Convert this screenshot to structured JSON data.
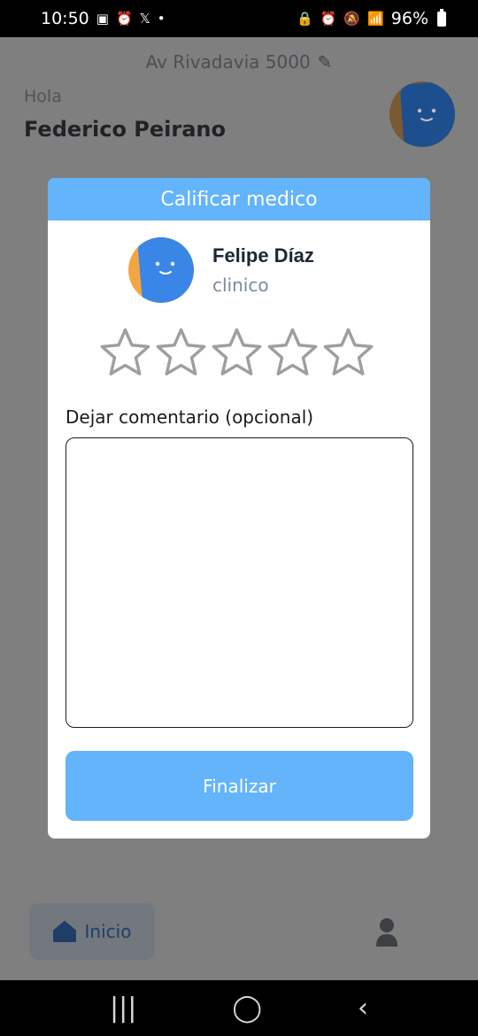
{
  "status_bar": {
    "time": "10:50",
    "battery": "96%",
    "icons": [
      "image-icon",
      "alarm-icon",
      "x-icon",
      "dot-icon",
      "lock-icon",
      "alarm-icon",
      "mute-icon",
      "wifi-icon",
      "volte-icon",
      "signal-icon",
      "battery-icon"
    ]
  },
  "header": {
    "address": "Av Rivadavia 5000",
    "greeting": "Hola",
    "user_name": "Federico Peirano"
  },
  "modal": {
    "title": "Calificar medico",
    "doctor_name": "Felipe Díaz",
    "doctor_specialty": "clinico",
    "rating": {
      "value": 0,
      "max": 5
    },
    "comment_label": "Dejar comentario (opcional)",
    "comment_value": "",
    "finish_label": "Finalizar"
  },
  "bottom_nav": {
    "home_label": "Inicio"
  },
  "colors": {
    "accent": "#63b4fb",
    "overlay": "#7f7f7f",
    "avatar_blue": "#3a86e6",
    "avatar_orange": "#f3a544"
  }
}
